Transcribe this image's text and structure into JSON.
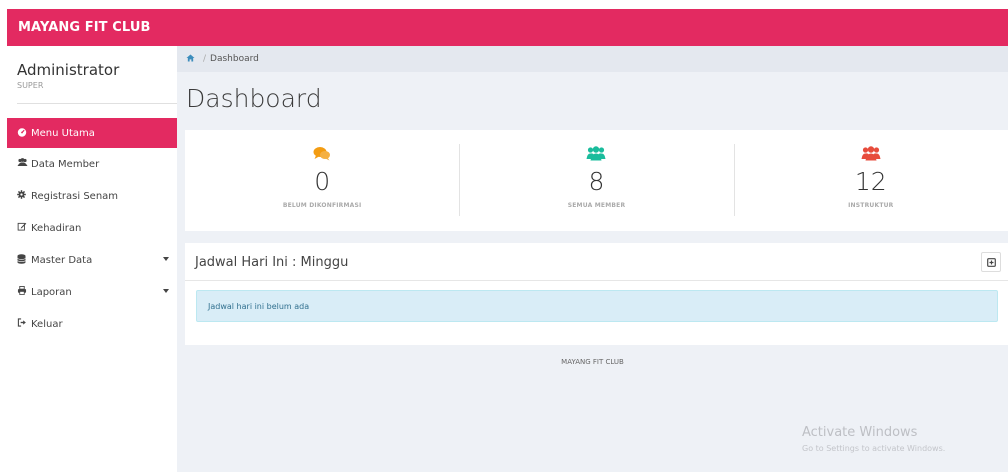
{
  "app": {
    "brand": "MAYANG FIT CLUB"
  },
  "user": {
    "name": "Administrator",
    "role": "SUPER"
  },
  "menu": [
    {
      "label": "Menu Utama",
      "icon": "dashboard-icon",
      "active": true
    },
    {
      "label": "Data Member",
      "icon": "users-icon"
    },
    {
      "label": "Registrasi Senam",
      "icon": "gear-icon"
    },
    {
      "label": "Kehadiran",
      "icon": "edit-icon"
    },
    {
      "label": "Master Data",
      "icon": "database-icon",
      "caret": true
    },
    {
      "label": "Laporan",
      "icon": "print-icon",
      "caret": true
    },
    {
      "label": "Keluar",
      "icon": "sign-out-icon"
    }
  ],
  "breadcrumb": {
    "current": "Dashboard"
  },
  "page": {
    "title": "Dashboard"
  },
  "stats": [
    {
      "value": "0",
      "label": "BELUM DIKONFIRMASI",
      "icon": "comments-icon",
      "color": "#f39c12"
    },
    {
      "value": "8",
      "label": "SEMUA MEMBER",
      "icon": "users-icon",
      "color": "#1abc9c"
    },
    {
      "value": "12",
      "label": "INSTRUKTUR",
      "icon": "users-icon",
      "color": "#e74c3c"
    }
  ],
  "schedule": {
    "title": "Jadwal Hari Ini : Minggu",
    "empty_message": "Jadwal hari ini belum ada"
  },
  "footer": {
    "text": "MAYANG FIT CLUB"
  },
  "watermark": {
    "title": "Activate Windows",
    "subtitle": "Go to Settings to activate Windows."
  },
  "colors": {
    "brand": "#e32a61",
    "info_bg": "#d9edf7",
    "info_text": "#31708f"
  }
}
